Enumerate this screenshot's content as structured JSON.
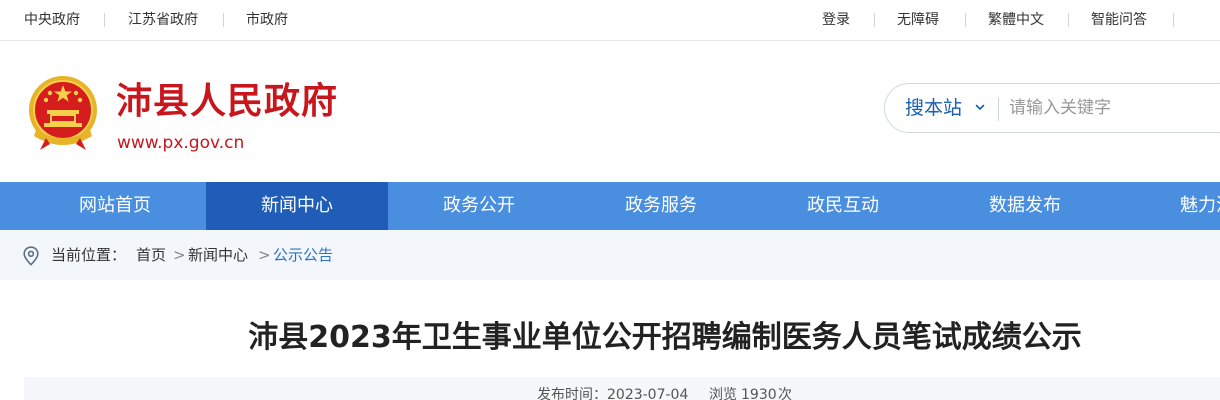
{
  "topbar": {
    "left_links": [
      "中央政府",
      "江苏省政府",
      "市政府"
    ],
    "right_links": [
      "登录",
      "无障碍",
      "繁體中文",
      "智能问答"
    ]
  },
  "header": {
    "site_title": "沛县人民政府",
    "site_url": "www.px.gov.cn",
    "emblem_icon": "national-emblem-icon",
    "brand_color": "#c8161d"
  },
  "search": {
    "scope": "搜本站",
    "placeholder": "请输入关键字",
    "accent_color": "#1a5fb4"
  },
  "nav": {
    "items": [
      "网站首页",
      "新闻中心",
      "政务公开",
      "政务服务",
      "政民互动",
      "数据发布",
      "魅力沛"
    ],
    "active": "新闻中心",
    "bar_color": "#4a8ee0",
    "active_color": "#1f5db8"
  },
  "breadcrumb": {
    "label": "当前位置：",
    "items": [
      "首页",
      "新闻中心",
      "公示公告"
    ],
    "separator": ">",
    "pin_icon": "location-pin-icon"
  },
  "article": {
    "title": "沛县2023年卫生事业单位公开招聘编制医务人员笔试成绩公示",
    "publish_label": "发布时间：",
    "publish_date": "2023-07-04",
    "views_label": "浏览",
    "views_count": "1930",
    "views_unit": "次"
  }
}
